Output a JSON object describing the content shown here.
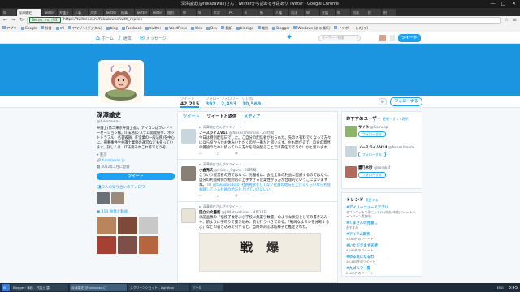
{
  "window": {
    "title": "深澤諭史(@fukazawas)さん | Twitterから認める手段あり Twitter - Google Chrome",
    "controls": [
      "—",
      "□",
      "✕"
    ]
  },
  "tabs": [
    "W",
    "深澤諭史",
    "Twitter",
    "弁護士",
    "人事",
    "大学",
    "Twitter",
    "刑事",
    "Twitter",
    "Twitter",
    "個別",
    "W",
    "W",
    "大学",
    "PC",
    "B",
    "新",
    "人権",
    "司法",
    "W",
    "弁護",
    "W",
    "司法",
    "民",
    "刑"
  ],
  "address": {
    "secure": "Twitter, Inc. [US]",
    "url": "https://twitter.com/fukazawas/with_replies"
  },
  "bookmarks": [
    "アプリ",
    "Google",
    "辞書",
    "ml",
    "アマゾン(デジタル)",
    "blog",
    "Facebook",
    "twitter",
    "WordPress",
    "Web",
    "Dev",
    "翻訳",
    "bleckgs",
    "裁判",
    "Blogger",
    "Windows (ある場所)",
    "インポートした(ブ)"
  ],
  "twnav": {
    "home": "ホーム",
    "notifications": "通知",
    "messages": "メッセージ",
    "search_placeholder": "キーワード検索",
    "tweet_button": "ツイート"
  },
  "stats": [
    {
      "label": "ツイート",
      "value": "42,215"
    },
    {
      "label": "フォロー",
      "value": "392"
    },
    {
      "label": "フォロワー",
      "value": "2,493"
    },
    {
      "label": "いいね",
      "value": "10,569"
    }
  ],
  "follow_label": "フォローする",
  "profile": {
    "name": "深澤諭史",
    "handle": "@fukazawas",
    "bio": "弁護士(第二東京弁護士会)。アイコンはフレドリーゼーション様。IT法務(システム開発紛争、ネットトラブル、名誉毀損、IT企業の一般法務)を中心に、刑事事件や弁護士業務の運営なども扱っています。詳しくは、IT法務あれこれ等でどうぞ。",
    "location": "東京",
    "website": "fukazawas.jp",
    "joined": "2012年3月に登録",
    "tweet_button": "ツイート",
    "followers_you_know": "2人の知り合いのフォロワー",
    "photos_label": "113 画像と動画"
  },
  "timeline_tabs": [
    "ツイート",
    "ツイートと返信",
    "メディア"
  ],
  "tweets": [
    {
      "context": "深澤諭史さんがリツイート",
      "name": "ノースライムV14",
      "handle": "@Noseslimeman",
      "time": "24時間",
      "text": "今日は特別配信日でした。ご自分の配信者がおられた。先のネ有料でくなって方々にほら役からかお休みいただくのが一番だと思います。左も間がるで。自分の意見の雑論のために続っている方々を何分配ることでは責任でできないかと思います。"
    },
    {
      "context": "深澤諭史さんがリツイート",
      "name": "小倉秀夫",
      "handle": "@Hideo_Ogura",
      "time": "28時間",
      "text": "こういう経営者の方ではなく、労働者は、会社全体の利益に配慮するのではなく、自分の利益確保が相対的に上手すぎる企業性から方が合理的というこになりますね。",
      "text_rt": "RT @takashisdoto: 社員貢献をしてない社員の給与を上げるくらいなら利益貢献している社員の給与を上げていけばいい。"
    },
    {
      "context": "深澤諭史さんがリツイート",
      "name": "国立公文書館",
      "handle": "@JPNatArchives",
      "time": "4月14日",
      "text": "承認画像の「播授子後呼ぶ小学校に無業引数書」のような状況としての書き込みや、前ように手時りで書き込み、前と行うべきである。「戦局なよスレを分断するよ」などの書き込みで引すると、当時の対応は成様子と推定された。",
      "kanji": [
        "戦",
        "爆"
      ]
    }
  ],
  "who_to_follow": {
    "title": "おすすめユーザー",
    "extras": "更新・すべて表示",
    "users": [
      {
        "name": "サイネ",
        "handle": "@Cainesp"
      },
      {
        "name": "ノースライムV14",
        "handle": "@Noseslimem"
      },
      {
        "name": "鷹乃木砂",
        "handle": "@koraksf"
      }
    ],
    "follow_label": "フォローする"
  },
  "trends": {
    "title": "トレンド",
    "extras": "変更する",
    "items": [
      {
        "name": "#デイリーニュースアプリ",
        "sub": "セブンネットで手に入る(?)(中古(中途)ツイートキャンペーン実施中)"
      },
      {
        "name": "#くまさんの見直し",
        "sub": "おすすめ"
      },
      {
        "name": "#アイテム新作",
        "sub": "5,165件のツイート"
      },
      {
        "name": "#いただきます天使",
        "sub": "9,180件のツイート"
      },
      {
        "name": "#ゆる気になるわ",
        "sub": "26,485件のツイート"
      },
      {
        "name": "#九ゴルフ一覧",
        "sub": "2,400件のツイート"
      }
    ]
  },
  "taskbar": {
    "items": [
      "Blogger: 事務 - 弁護士 論",
      "深澤諭史(@fukazawa)さ",
      "スクリーンショット - Lightbox",
      "ツール"
    ],
    "tray": "ENG",
    "clock": "8:45"
  },
  "colors": {
    "accent": "#1da1f2",
    "banner": "#1b95e0"
  }
}
